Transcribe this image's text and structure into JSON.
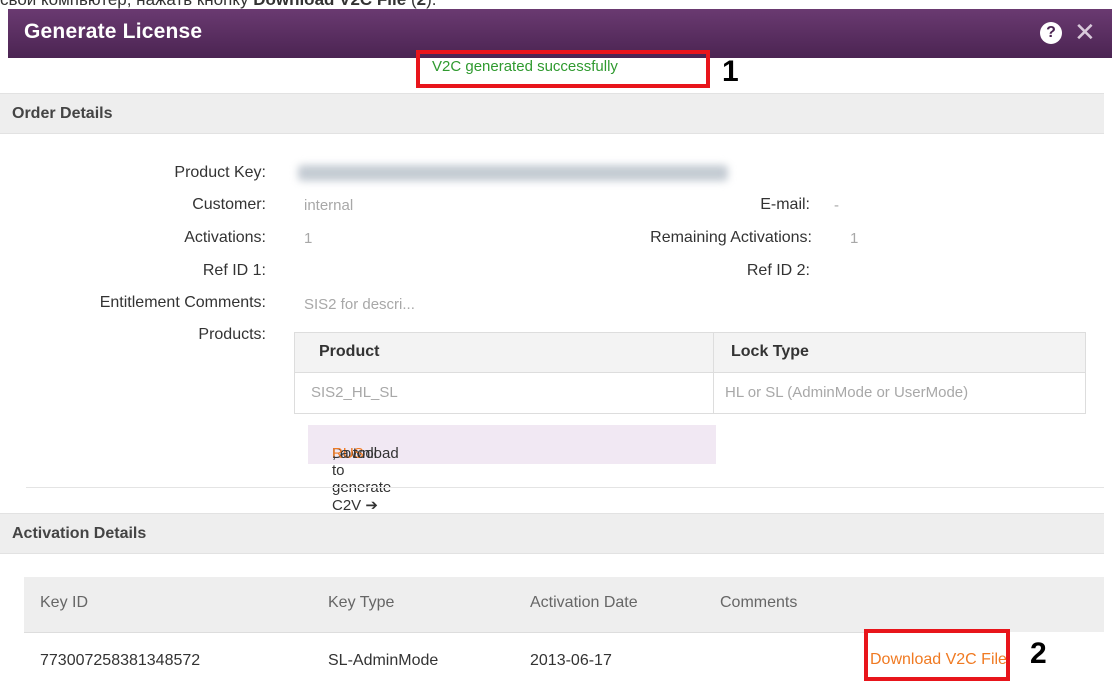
{
  "page_top_text": {
    "prefix": "свой компьютер, нажать кнопку ",
    "bold1": "Download V2C File",
    "suffix": " (",
    "bold2": "2",
    "end": ")."
  },
  "dialog": {
    "title": "Generate License",
    "help_icon": "question-mark-icon",
    "help_glyph": "?",
    "close_icon": "close-icon",
    "close_glyph": "✕"
  },
  "status": {
    "message": "V2C generated successfully",
    "color": "#2f9a2f"
  },
  "annotations": {
    "marker_1": "1",
    "marker_2": "2",
    "highlight_color": "#e8151b"
  },
  "order_details": {
    "header": "Order Details",
    "labels": {
      "product_key": "Product Key:",
      "customer": "Customer:",
      "activations": "Activations:",
      "ref_id_1": "Ref ID 1:",
      "entitlement_comments": "Entitlement Comments:",
      "products": "Products:",
      "email": "E-mail:",
      "remaining_activations": "Remaining Activations:",
      "ref_id_2": "Ref ID 2:"
    },
    "values": {
      "customer": "internal",
      "activations": "1",
      "entitlement_comments": "SIS2 for descri...",
      "email": "-",
      "remaining_activations": "1"
    },
    "products_table": {
      "columns": [
        "Product",
        "Lock Type"
      ],
      "rows": [
        [
          "SIS2_HL_SL",
          "HL or SL (AdminMode or UserMode)"
        ]
      ]
    },
    "rus_link": {
      "prefix": "Download ",
      "link": "RUS",
      "suffix": ", a tool to generate C2V ➔"
    }
  },
  "activation_details": {
    "header": "Activation Details",
    "columns": [
      "Key ID",
      "Key Type",
      "Activation Date",
      "Comments"
    ],
    "rows": [
      [
        "773007258381348572",
        "SL-AdminMode",
        "2013-06-17",
        ""
      ]
    ],
    "download_label": "Download V2C File"
  },
  "colors": {
    "title_bar": "#4b2452",
    "link_orange": "#f07a22"
  }
}
